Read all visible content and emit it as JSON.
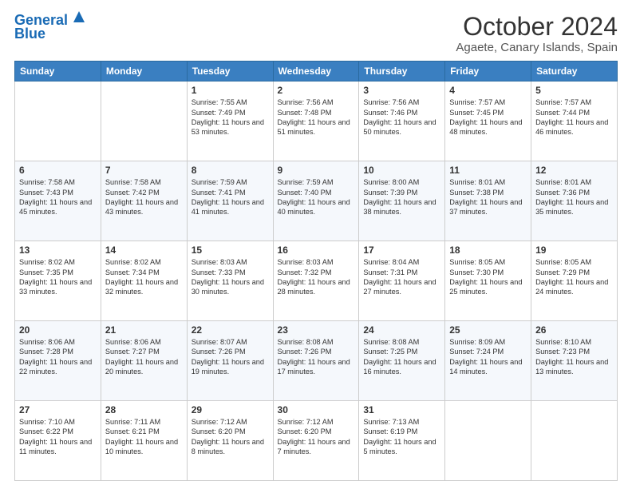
{
  "logo": {
    "line1": "General",
    "line2": "Blue"
  },
  "title": "October 2024",
  "subtitle": "Agaete, Canary Islands, Spain",
  "headers": [
    "Sunday",
    "Monday",
    "Tuesday",
    "Wednesday",
    "Thursday",
    "Friday",
    "Saturday"
  ],
  "weeks": [
    [
      {
        "day": "",
        "content": ""
      },
      {
        "day": "",
        "content": ""
      },
      {
        "day": "1",
        "content": "Sunrise: 7:55 AM\nSunset: 7:49 PM\nDaylight: 11 hours and 53 minutes."
      },
      {
        "day": "2",
        "content": "Sunrise: 7:56 AM\nSunset: 7:48 PM\nDaylight: 11 hours and 51 minutes."
      },
      {
        "day": "3",
        "content": "Sunrise: 7:56 AM\nSunset: 7:46 PM\nDaylight: 11 hours and 50 minutes."
      },
      {
        "day": "4",
        "content": "Sunrise: 7:57 AM\nSunset: 7:45 PM\nDaylight: 11 hours and 48 minutes."
      },
      {
        "day": "5",
        "content": "Sunrise: 7:57 AM\nSunset: 7:44 PM\nDaylight: 11 hours and 46 minutes."
      }
    ],
    [
      {
        "day": "6",
        "content": "Sunrise: 7:58 AM\nSunset: 7:43 PM\nDaylight: 11 hours and 45 minutes."
      },
      {
        "day": "7",
        "content": "Sunrise: 7:58 AM\nSunset: 7:42 PM\nDaylight: 11 hours and 43 minutes."
      },
      {
        "day": "8",
        "content": "Sunrise: 7:59 AM\nSunset: 7:41 PM\nDaylight: 11 hours and 41 minutes."
      },
      {
        "day": "9",
        "content": "Sunrise: 7:59 AM\nSunset: 7:40 PM\nDaylight: 11 hours and 40 minutes."
      },
      {
        "day": "10",
        "content": "Sunrise: 8:00 AM\nSunset: 7:39 PM\nDaylight: 11 hours and 38 minutes."
      },
      {
        "day": "11",
        "content": "Sunrise: 8:01 AM\nSunset: 7:38 PM\nDaylight: 11 hours and 37 minutes."
      },
      {
        "day": "12",
        "content": "Sunrise: 8:01 AM\nSunset: 7:36 PM\nDaylight: 11 hours and 35 minutes."
      }
    ],
    [
      {
        "day": "13",
        "content": "Sunrise: 8:02 AM\nSunset: 7:35 PM\nDaylight: 11 hours and 33 minutes."
      },
      {
        "day": "14",
        "content": "Sunrise: 8:02 AM\nSunset: 7:34 PM\nDaylight: 11 hours and 32 minutes."
      },
      {
        "day": "15",
        "content": "Sunrise: 8:03 AM\nSunset: 7:33 PM\nDaylight: 11 hours and 30 minutes."
      },
      {
        "day": "16",
        "content": "Sunrise: 8:03 AM\nSunset: 7:32 PM\nDaylight: 11 hours and 28 minutes."
      },
      {
        "day": "17",
        "content": "Sunrise: 8:04 AM\nSunset: 7:31 PM\nDaylight: 11 hours and 27 minutes."
      },
      {
        "day": "18",
        "content": "Sunrise: 8:05 AM\nSunset: 7:30 PM\nDaylight: 11 hours and 25 minutes."
      },
      {
        "day": "19",
        "content": "Sunrise: 8:05 AM\nSunset: 7:29 PM\nDaylight: 11 hours and 24 minutes."
      }
    ],
    [
      {
        "day": "20",
        "content": "Sunrise: 8:06 AM\nSunset: 7:28 PM\nDaylight: 11 hours and 22 minutes."
      },
      {
        "day": "21",
        "content": "Sunrise: 8:06 AM\nSunset: 7:27 PM\nDaylight: 11 hours and 20 minutes."
      },
      {
        "day": "22",
        "content": "Sunrise: 8:07 AM\nSunset: 7:26 PM\nDaylight: 11 hours and 19 minutes."
      },
      {
        "day": "23",
        "content": "Sunrise: 8:08 AM\nSunset: 7:26 PM\nDaylight: 11 hours and 17 minutes."
      },
      {
        "day": "24",
        "content": "Sunrise: 8:08 AM\nSunset: 7:25 PM\nDaylight: 11 hours and 16 minutes."
      },
      {
        "day": "25",
        "content": "Sunrise: 8:09 AM\nSunset: 7:24 PM\nDaylight: 11 hours and 14 minutes."
      },
      {
        "day": "26",
        "content": "Sunrise: 8:10 AM\nSunset: 7:23 PM\nDaylight: 11 hours and 13 minutes."
      }
    ],
    [
      {
        "day": "27",
        "content": "Sunrise: 7:10 AM\nSunset: 6:22 PM\nDaylight: 11 hours and 11 minutes."
      },
      {
        "day": "28",
        "content": "Sunrise: 7:11 AM\nSunset: 6:21 PM\nDaylight: 11 hours and 10 minutes."
      },
      {
        "day": "29",
        "content": "Sunrise: 7:12 AM\nSunset: 6:20 PM\nDaylight: 11 hours and 8 minutes."
      },
      {
        "day": "30",
        "content": "Sunrise: 7:12 AM\nSunset: 6:20 PM\nDaylight: 11 hours and 7 minutes."
      },
      {
        "day": "31",
        "content": "Sunrise: 7:13 AM\nSunset: 6:19 PM\nDaylight: 11 hours and 5 minutes."
      },
      {
        "day": "",
        "content": ""
      },
      {
        "day": "",
        "content": ""
      }
    ]
  ]
}
